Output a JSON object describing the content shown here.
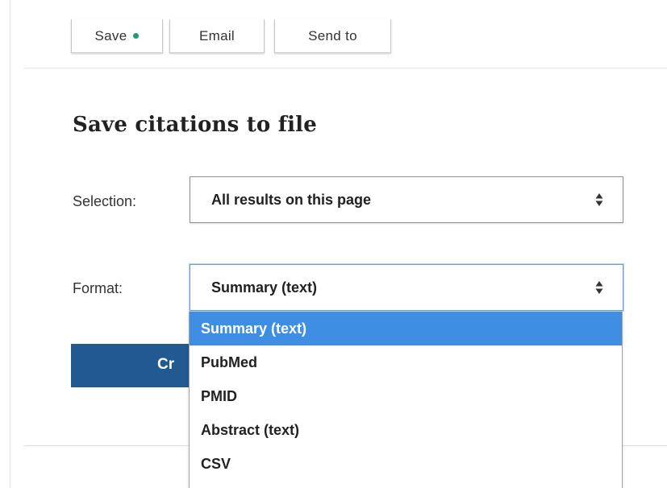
{
  "toolbar": {
    "save_label": "Save",
    "email_label": "Email",
    "send_to_label": "Send to",
    "save_dot_color": "#1e9c72"
  },
  "panel": {
    "title": "Save citations to file",
    "selection_label": "Selection:",
    "selection_value": "All results on this page",
    "format_label": "Format:",
    "format_value": "Summary (text)",
    "create_label": "Create file",
    "create_visible_text": "Cr"
  },
  "dropdown": {
    "options": [
      "Summary (text)",
      "PubMed",
      "PMID",
      "Abstract (text)",
      "CSV"
    ],
    "selected_index": 0,
    "highlight_color": "#3e8ee4"
  },
  "colors": {
    "primary_button": "#215a91",
    "focus_border": "#6e9fd4"
  }
}
